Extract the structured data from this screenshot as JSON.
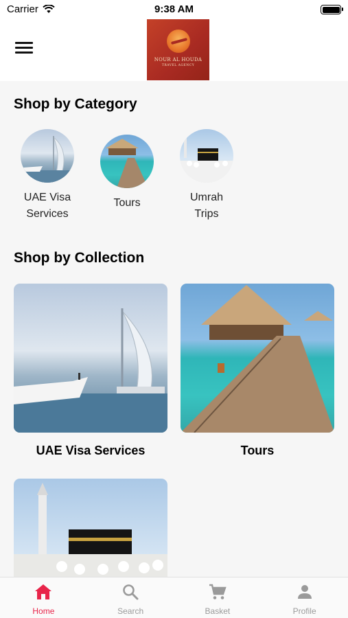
{
  "status_bar": {
    "carrier": "Carrier",
    "time": "9:38 AM"
  },
  "header": {
    "logo_text": "NOUR AL HOUDA",
    "logo_subtext": "TRAVEL AGENCY",
    "menu_icon": "hamburger-menu-icon"
  },
  "category_section": {
    "title": "Shop by Category",
    "items": [
      {
        "label_line1": "UAE Visa",
        "label_line2": "Services",
        "image": "burj-al-arab"
      },
      {
        "label_line1": "Tours",
        "label_line2": "",
        "image": "overwater-villas"
      },
      {
        "label_line1": "Umrah",
        "label_line2": "Trips",
        "image": "kaaba"
      }
    ]
  },
  "collection_section": {
    "title": "Shop by Collection",
    "items": [
      {
        "label": "UAE Visa Services",
        "image": "burj-al-arab"
      },
      {
        "label": "Tours",
        "image": "overwater-villas"
      },
      {
        "label": "",
        "image": "kaaba"
      }
    ]
  },
  "tab_bar": {
    "tabs": [
      {
        "label": "Home",
        "icon": "home-icon",
        "active": true
      },
      {
        "label": "Search",
        "icon": "search-icon",
        "active": false
      },
      {
        "label": "Basket",
        "icon": "cart-icon",
        "active": false
      },
      {
        "label": "Profile",
        "icon": "person-icon",
        "active": false
      }
    ],
    "active_color": "#e8254a",
    "inactive_color": "#9a9a9a"
  }
}
